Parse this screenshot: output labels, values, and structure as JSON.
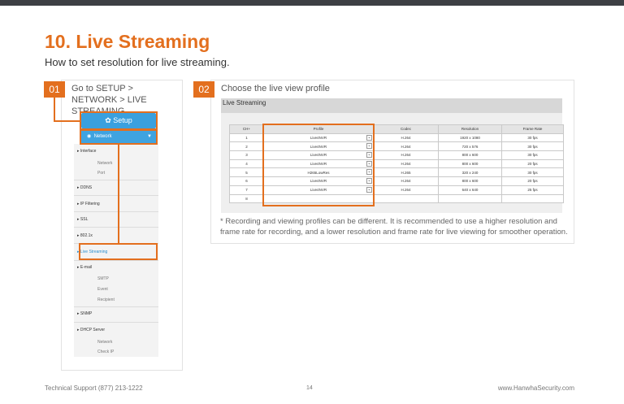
{
  "header": {
    "number": "10.",
    "title": "Live Streaming",
    "subtitle": "How to set resolution for live streaming."
  },
  "steps": [
    {
      "badge": "01",
      "text": "Go to SETUP > NETWORK > LIVE STREAMING"
    },
    {
      "badge": "02",
      "text": "Choose the live view profile"
    }
  ],
  "setup_menu": {
    "setup_label": "Setup",
    "network_label": "Network",
    "items": [
      {
        "label": "Interface",
        "subitems": [
          "Network",
          "Port"
        ]
      },
      {
        "label": "DDNS",
        "subitems": []
      },
      {
        "label": "IP Filtering",
        "subitems": []
      },
      {
        "label": "SSL",
        "subitems": []
      },
      {
        "label": "802.1x",
        "subitems": []
      },
      {
        "label": "Live Streaming",
        "subitems": []
      },
      {
        "label": "E-mail",
        "subitems": [
          "SMTP",
          "Event",
          "Recipient"
        ]
      },
      {
        "label": "SNMP",
        "subitems": []
      },
      {
        "label": "DHCP Server",
        "subitems": [
          "Network",
          "Check IP"
        ]
      }
    ]
  },
  "live_streaming": {
    "title": "Live Streaming",
    "columns": [
      "CH+",
      "Profile",
      "Codec",
      "Resolution",
      "Frame Rate"
    ],
    "rows": [
      [
        "1",
        "Live4NVR",
        "H.264",
        "1920 x 1080",
        "30 fps"
      ],
      [
        "2",
        "Live4NVR",
        "H.264",
        "720 x 576",
        "30 fps"
      ],
      [
        "3",
        "Live4NVR",
        "H.264",
        "800 x 600",
        "30 fps"
      ],
      [
        "4",
        "Live4NVR",
        "H.264",
        "800 x 600",
        "20 fps"
      ],
      [
        "5",
        "H265LowRes",
        "H.265",
        "320 x 240",
        "30 fps"
      ],
      [
        "6",
        "Live4NVR",
        "H.264",
        "800 x 600",
        "20 fps"
      ],
      [
        "7",
        "Live4NVR",
        "H.264",
        "640 x 640",
        "25 fps"
      ],
      [
        "8",
        "",
        "",
        "",
        ""
      ]
    ]
  },
  "note": "* Recording and viewing profiles can be different. It is recommended to use a higher resolution and frame rate for recording, and a lower resolution and frame rate for live viewing for smoother operation.",
  "footer": {
    "support": "Technical Support (877) 213-1222",
    "page": "14",
    "website": "www.HanwhaSecurity.com"
  },
  "colors": {
    "accent": "#e36f1e",
    "setup_blue": "#3aa0de",
    "top_bar": "#3d3f44"
  }
}
